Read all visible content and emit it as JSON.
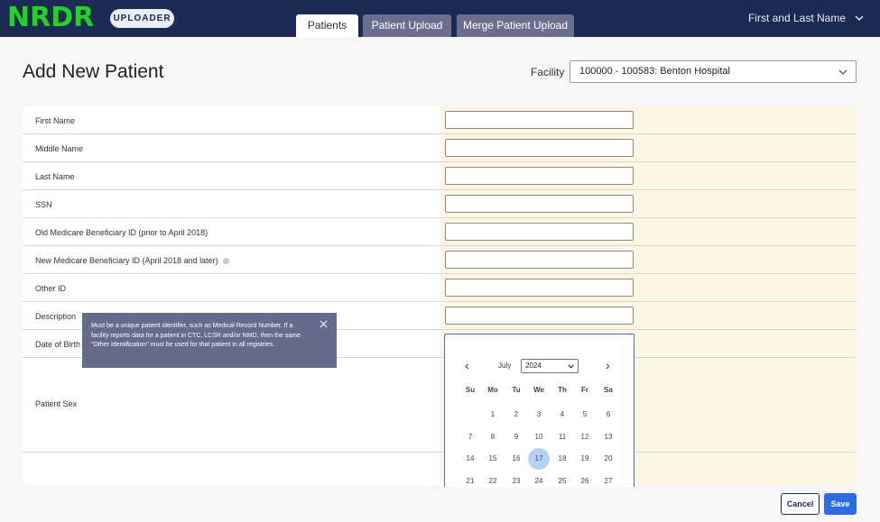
{
  "header": {
    "logo": "NRDR",
    "badge": "UPLOADER",
    "tabs": [
      {
        "label": "Patients",
        "active": true
      },
      {
        "label": "Patient Upload",
        "active": false
      },
      {
        "label": "Merge Patient Upload",
        "active": false
      }
    ],
    "user_name": "First and Last Name",
    "user_icon": "chevron-down-icon"
  },
  "page": {
    "title": "Add New Patient",
    "facility_label": "Facility",
    "facility_value": "100000 - 100583:  Benton Hospital"
  },
  "form": {
    "fields": [
      {
        "label": "First Name",
        "value": ""
      },
      {
        "label": "Middle Name",
        "value": ""
      },
      {
        "label": "Last Name",
        "value": ""
      },
      {
        "label": "SSN",
        "value": ""
      },
      {
        "label": "Old Medicare Beneficiary ID (prior to April 2018)",
        "value": ""
      },
      {
        "label": "New Medicare Beneficiary ID (April 2018 and later)",
        "value": ""
      },
      {
        "label": "Other ID",
        "value": ""
      },
      {
        "label": "Description",
        "value": ""
      },
      {
        "label": "Date of Birth",
        "value": ""
      },
      {
        "label": "Patient Sex",
        "value": ""
      }
    ]
  },
  "tooltip": {
    "text": "Must be a unique patient identifier, such as Medical Record Number. If a facility reports data for a patient in CTC, LCSR and/or NMD, then the same \"Other Identification\" must be used for that patient in all registries."
  },
  "calendar": {
    "month": "July",
    "year": "2024",
    "weekdays": [
      "Su",
      "Mo",
      "Tu",
      "We",
      "Th",
      "Fr",
      "Sa"
    ],
    "weeks": [
      [
        "",
        "1",
        "2",
        "3",
        "4",
        "5",
        "6"
      ],
      [
        "7",
        "8",
        "9",
        "10",
        "11",
        "12",
        "13"
      ],
      [
        "14",
        "15",
        "16",
        "17",
        "18",
        "19",
        "20"
      ],
      [
        "21",
        "22",
        "23",
        "24",
        "25",
        "26",
        "27"
      ]
    ],
    "selected_day": "17"
  },
  "actions": {
    "cancel": "Cancel",
    "save": "Save"
  },
  "colors": {
    "header_bg": "#1c2a55",
    "logo": "#22d321",
    "accent": "#2d6ae6",
    "input_pane": "#fdf6e3",
    "tooltip_bg": "#666b8e"
  }
}
